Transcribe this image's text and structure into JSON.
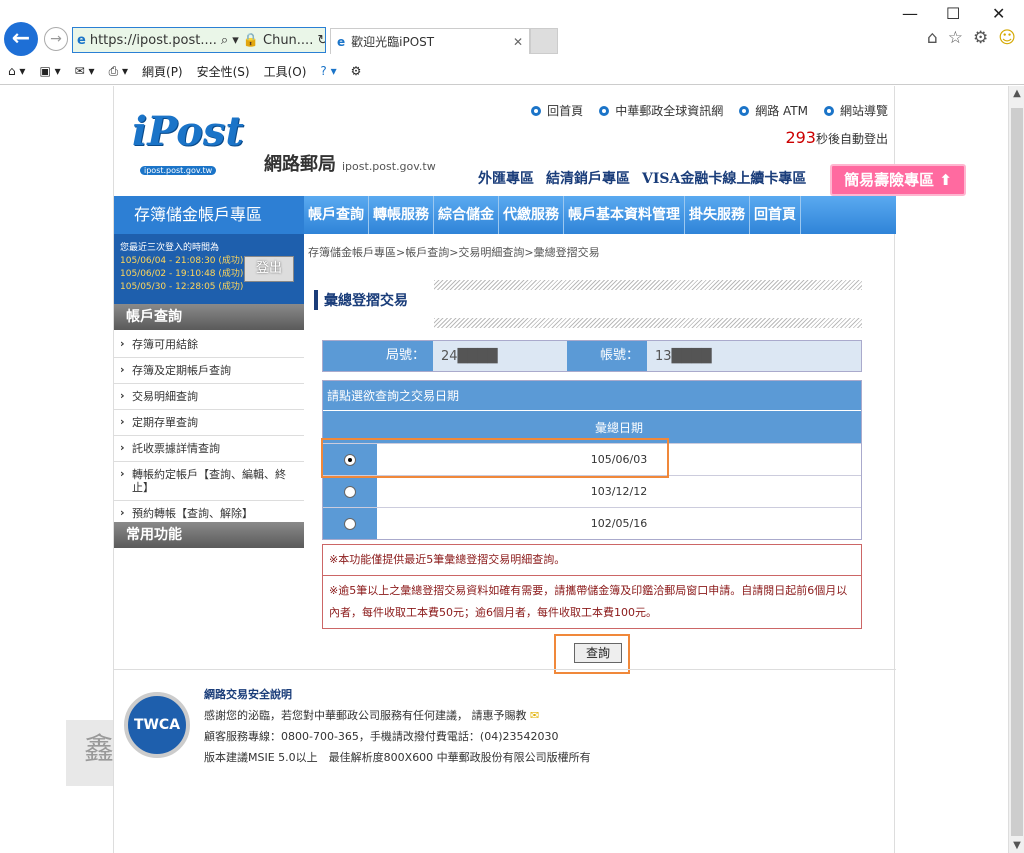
{
  "browser": {
    "url": "https://ipost.post....",
    "address_search_hint": "⌕ ▾",
    "site_identity": "Chun....",
    "tab_title": "歡迎光臨iPOST",
    "menu": {
      "page": "網頁(P)",
      "safety": "安全性(S)",
      "tools": "工具(O)"
    }
  },
  "header": {
    "logo_text": "iPost",
    "logo_url": "ipost.post.gov.tw",
    "brand": "網路郵局",
    "brand_url": "ipost.post.gov.tw",
    "top_links": [
      "回首頁",
      "中華郵政全球資訊網",
      "網路 ATM",
      "網站導覽"
    ],
    "countdown_num": "293",
    "countdown_text": "秒後自動登出",
    "specials": [
      "外匯專區",
      "結清銷戶專區",
      "VISA金融卡線上續卡專區"
    ],
    "life_btn": "簡易壽險專區 ⬆"
  },
  "sidebar": {
    "title": "存簿儲金帳戶專區",
    "login_label": "您最近三次登入的時間為",
    "logins": [
      "105/06/04 - 21:08:30 (成功)",
      "105/06/02 - 19:10:48 (成功)",
      "105/05/30 - 12:28:05 (成功)"
    ],
    "logout": "登出",
    "section1": "帳戶查詢",
    "items": [
      "存簿可用結餘",
      "存簿及定期帳戶查詢",
      "交易明細查詢",
      "定期存單查詢",
      "託收票據詳情查詢",
      "轉帳約定帳戶【查詢、編輯、終止】",
      "預約轉帳【查詢、解除】"
    ],
    "section2": "常用功能"
  },
  "nav": [
    "帳戶查詢",
    "轉帳服務",
    "綜合儲金",
    "代繳服務",
    "帳戶基本資料管理",
    "掛失服務",
    "回首頁"
  ],
  "main": {
    "breadcrumb": "存簿儲金帳戶專區>帳戶查詢>交易明細查詢>彙總登摺交易",
    "title": "彙總登摺交易",
    "branch_label": "局號：",
    "branch_value": "24████",
    "account_label": "帳號：",
    "account_value": "13████",
    "select_prompt": "請點選欲查詢之交易日期",
    "date_header": "彙總日期",
    "dates": [
      "105/06/03",
      "103/12/12",
      "102/05/16"
    ],
    "selected_index": 0,
    "note1": "※本功能僅提供最近5筆彙總登摺交易明細查詢。",
    "note2": "※逾5筆以上之彙總登摺交易資料如確有需要，請攜帶儲金簿及印鑑洽郵局窗口申請。自請閱日起前6個月以內者，每件收取工本費50元；逾6個月者，每件收取工本費100元。",
    "query": "查詢"
  },
  "footer": {
    "title": "網路交易安全說明",
    "line1": "感謝您的泌臨，若您對中華郵政公司服務有任何建議， 請惠予賜教",
    "line2": "顧客服務專線：0800-700-365，手機請改撥付費電話：(04)23542030",
    "line3": "版本建議MSIE 5.0以上　最佳解析度800X600 中華郵政股份有限公司版權所有",
    "seal": "TWCA"
  },
  "colors": {
    "accent": "#1b74c8",
    "highlight": "#f0883a",
    "note": "#8b1a1a"
  }
}
